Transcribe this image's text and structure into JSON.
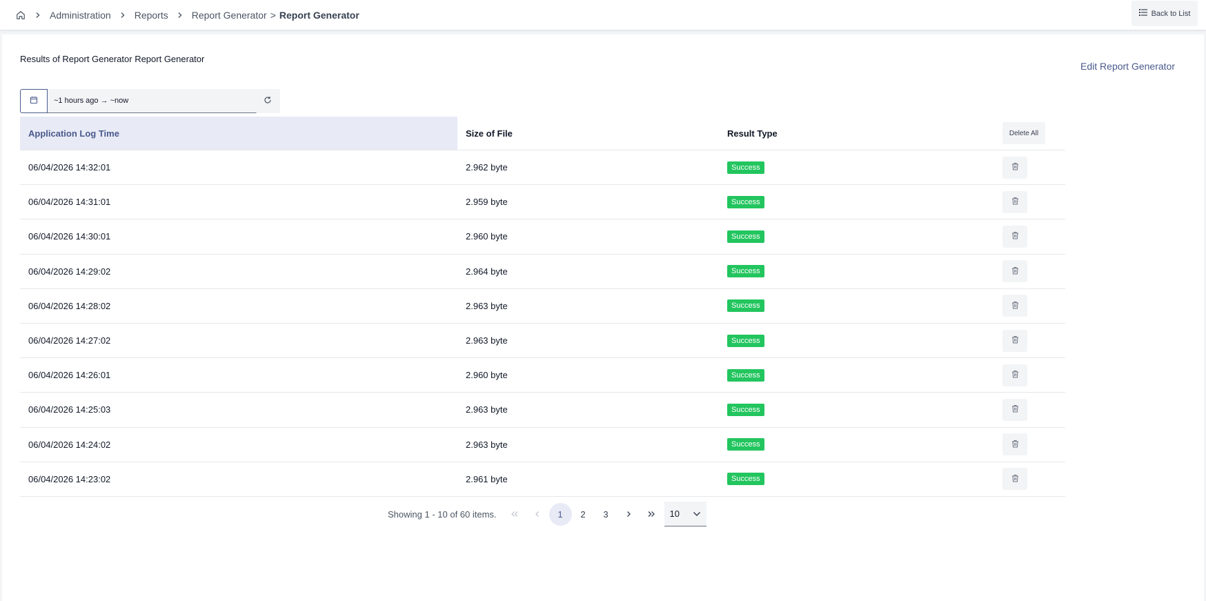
{
  "breadcrumb": {
    "items": [
      "Administration",
      "Reports",
      "Report Generator"
    ],
    "separator": ">",
    "current": "Report Generator"
  },
  "header": {
    "back_label": "Back to List"
  },
  "main": {
    "title": "Results of Report Generator Report Generator",
    "edit_label": "Edit Report Generator",
    "date_range": "~1 hours ago → ~now"
  },
  "table": {
    "columns": [
      "Application Log Time",
      "Size of File",
      "Result Type"
    ],
    "delete_all_label": "Delete All",
    "rows": [
      {
        "time": "06/04/2026 14:32:01",
        "size": "2.962 byte",
        "result": "Success"
      },
      {
        "time": "06/04/2026 14:31:01",
        "size": "2.959 byte",
        "result": "Success"
      },
      {
        "time": "06/04/2026 14:30:01",
        "size": "2.960 byte",
        "result": "Success"
      },
      {
        "time": "06/04/2026 14:29:02",
        "size": "2.964 byte",
        "result": "Success"
      },
      {
        "time": "06/04/2026 14:28:02",
        "size": "2.963 byte",
        "result": "Success"
      },
      {
        "time": "06/04/2026 14:27:02",
        "size": "2.963 byte",
        "result": "Success"
      },
      {
        "time": "06/04/2026 14:26:01",
        "size": "2.960 byte",
        "result": "Success"
      },
      {
        "time": "06/04/2026 14:25:03",
        "size": "2.963 byte",
        "result": "Success"
      },
      {
        "time": "06/04/2026 14:24:02",
        "size": "2.963 byte",
        "result": "Success"
      },
      {
        "time": "06/04/2026 14:23:02",
        "size": "2.961 byte",
        "result": "Success"
      }
    ]
  },
  "pagination": {
    "info": "Showing 1 - 10 of 60 items.",
    "pages": [
      "1",
      "2",
      "3"
    ],
    "current_page": "1",
    "page_size": "10"
  },
  "colors": {
    "accent": "#4a5a8c",
    "header_highlight": "#e8eaf6",
    "success": "#22c55e"
  },
  "icons": [
    "home-icon",
    "chevron-right-icon",
    "list-icon",
    "calendar-icon",
    "refresh-icon",
    "trash-icon",
    "double-chevron-left-icon",
    "chevron-left-icon",
    "double-chevron-right-icon",
    "chevron-down-icon"
  ]
}
